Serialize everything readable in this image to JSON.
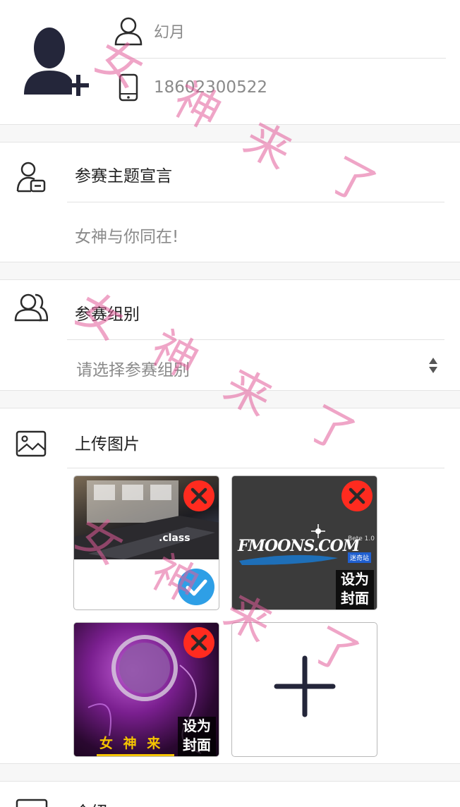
{
  "profile": {
    "name": "幻月",
    "phone": "18602300522"
  },
  "declaration": {
    "label": "参赛主题宣言",
    "value": "女神与你同在!"
  },
  "group": {
    "label": "参赛组别",
    "placeholder": "请选择参赛组别"
  },
  "upload": {
    "label": "上传图片",
    "images": [
      {
        "caption": ".class",
        "cover_set": true
      },
      {
        "logo": "FMOONS.COM",
        "version": "Bete 1.0",
        "badge": "迷奇站",
        "cover_label": "设为封面"
      },
      {
        "caption": "女 神 来",
        "cover_label": "设为封面"
      }
    ]
  },
  "intro": {
    "label": "介绍"
  },
  "watermark": {
    "chars": [
      "女",
      "神",
      "来",
      "了"
    ]
  },
  "colors": {
    "delete": "#ff2b1f",
    "check": "#2e9fe6",
    "watermark": "#e25c9a"
  }
}
